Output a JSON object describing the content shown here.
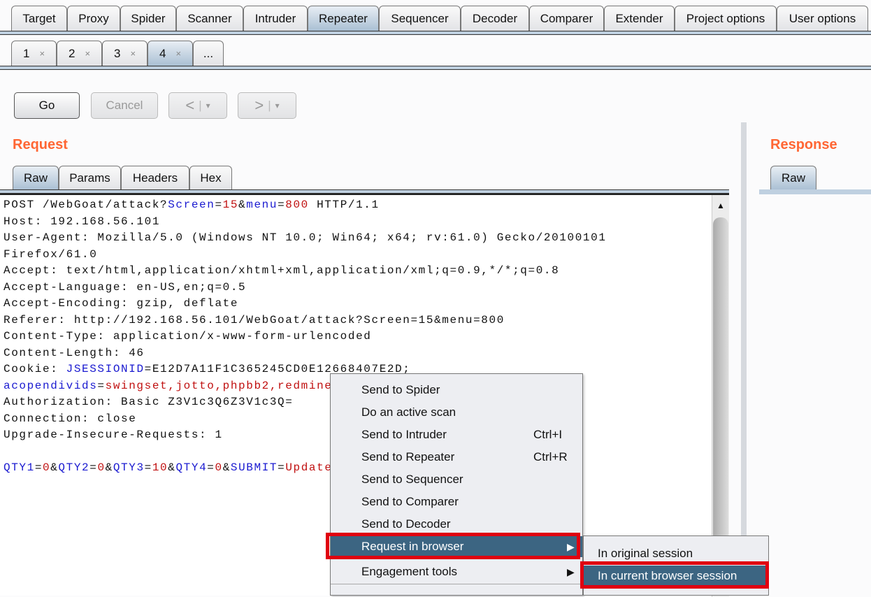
{
  "top_tabs": [
    "Target",
    "Proxy",
    "Spider",
    "Scanner",
    "Intruder",
    "Repeater",
    "Sequencer",
    "Decoder",
    "Comparer",
    "Extender",
    "Project options",
    "User options"
  ],
  "active_top_tab": "Repeater",
  "repeater_tabs": [
    "1",
    "2",
    "3",
    "4",
    "..."
  ],
  "close_glyph": "×",
  "toolbar": {
    "go": "Go",
    "cancel": "Cancel",
    "back": "<",
    "forward": ">",
    "dropdown": "▾"
  },
  "request": {
    "title": "Request",
    "tabs": [
      "Raw",
      "Params",
      "Headers",
      "Hex"
    ],
    "lines": [
      [
        [
          "POST /WebGoat/attack?",
          ""
        ],
        [
          "Screen",
          "n"
        ],
        [
          "=",
          ""
        ],
        [
          "15",
          "v"
        ],
        [
          "&",
          ""
        ],
        [
          "menu",
          "n"
        ],
        [
          "=",
          ""
        ],
        [
          "800",
          "v"
        ],
        [
          " HTTP/1.1",
          ""
        ]
      ],
      [
        [
          "Host: 192.168.56.101",
          ""
        ]
      ],
      [
        [
          "User-Agent: Mozilla/5.0 (Windows NT 10.0; Win64; x64; rv:61.0) Gecko/20100101",
          ""
        ]
      ],
      [
        [
          "Firefox/61.0",
          ""
        ]
      ],
      [
        [
          "Accept: text/html,application/xhtml+xml,application/xml;q=0.9,*/*;q=0.8",
          ""
        ]
      ],
      [
        [
          "Accept-Language: en-US,en;q=0.5",
          ""
        ]
      ],
      [
        [
          "Accept-Encoding: gzip, deflate",
          ""
        ]
      ],
      [
        [
          "Referer: http://192.168.56.101/WebGoat/attack?Screen=15&menu=800",
          ""
        ]
      ],
      [
        [
          "Content-Type: application/x-www-form-urlencoded",
          ""
        ]
      ],
      [
        [
          "Content-Length: 46",
          ""
        ]
      ],
      [
        [
          "Cookie: ",
          ""
        ],
        [
          "JSESSIONID",
          "n"
        ],
        [
          "=",
          ""
        ],
        [
          "E12D7A11F1C365245CD0E12668407E2D",
          ""
        ],
        [
          ";",
          ""
        ]
      ],
      [
        [
          "acopendivids",
          "n"
        ],
        [
          "=",
          ""
        ],
        [
          "swingset,jotto,phpbb2,redmine",
          "v"
        ]
      ],
      [
        [
          "Authorization: Basic Z3V1c3Q6Z3V1c3Q=",
          ""
        ]
      ],
      [
        [
          "Connection: close",
          ""
        ]
      ],
      [
        [
          "Upgrade-Insecure-Requests: 1",
          ""
        ]
      ],
      [
        [
          "",
          ""
        ]
      ],
      [
        [
          "QTY1",
          "n"
        ],
        [
          "=",
          ""
        ],
        [
          "0",
          "v"
        ],
        [
          "&",
          ""
        ],
        [
          "QTY2",
          "n"
        ],
        [
          "=",
          ""
        ],
        [
          "0",
          "v"
        ],
        [
          "&",
          ""
        ],
        [
          "QTY3",
          "n"
        ],
        [
          "=",
          ""
        ],
        [
          "10",
          "v"
        ],
        [
          "&",
          ""
        ],
        [
          "QTY4",
          "n"
        ],
        [
          "=",
          ""
        ],
        [
          "0",
          "v"
        ],
        [
          "&",
          ""
        ],
        [
          "SUBMIT",
          "n"
        ],
        [
          "=",
          ""
        ],
        [
          "Update",
          "v"
        ]
      ]
    ]
  },
  "response": {
    "title": "Response",
    "tabs": [
      "Raw"
    ]
  },
  "context_menu": {
    "items": [
      {
        "label": "Send to Spider"
      },
      {
        "label": "Do an active scan"
      },
      {
        "label": "Send to Intruder",
        "shortcut": "Ctrl+I"
      },
      {
        "label": "Send to Repeater",
        "shortcut": "Ctrl+R"
      },
      {
        "label": "Send to Sequencer"
      },
      {
        "label": "Send to Comparer"
      },
      {
        "label": "Send to Decoder"
      },
      {
        "label": "Request in browser",
        "submenu": "▶",
        "highlighted": true
      },
      {
        "label": "Engagement tools",
        "submenu": "▶"
      }
    ],
    "submenu": [
      {
        "label": "In original session"
      },
      {
        "label": "In current browser session",
        "highlighted": true
      }
    ]
  },
  "colors": {
    "accent": "#ff6633",
    "highlight": "#3c6582",
    "callout": "#e00010"
  }
}
